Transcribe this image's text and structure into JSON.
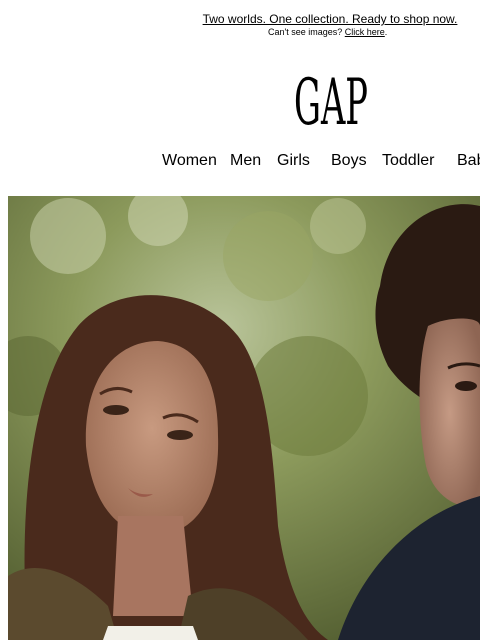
{
  "preheader": {
    "headline": "Two worlds. One collection. Ready to shop now.",
    "cant_see_text": "Can't see images? ",
    "click_here": "Click here",
    "period": "."
  },
  "brand": {
    "logo_text": "GAP"
  },
  "nav": {
    "items": [
      {
        "label": "Women"
      },
      {
        "label": "Men"
      },
      {
        "label": "Girls"
      },
      {
        "label": "Boys"
      },
      {
        "label": "Toddler"
      },
      {
        "label": "Bab"
      }
    ]
  },
  "hero": {
    "image": "couple-portrait-photo"
  },
  "colors": {
    "background": "#ffffff",
    "text": "#000000"
  }
}
